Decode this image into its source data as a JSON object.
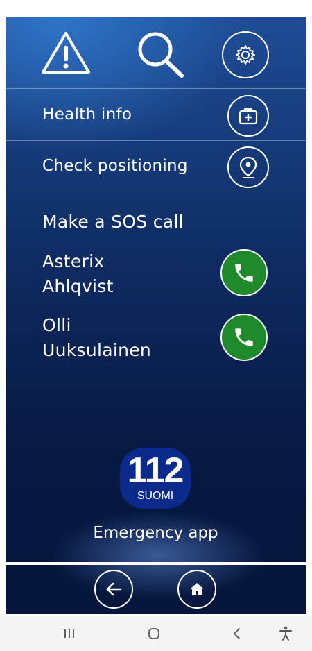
{
  "menu": {
    "health_info": "Health info",
    "check_positioning": "Check positioning"
  },
  "sos": {
    "heading": "Make a SOS call",
    "contacts": [
      {
        "first_name": "Asterix",
        "last_name": "Ahlqvist"
      },
      {
        "first_name": "Olli",
        "last_name": "Uuksulainen"
      }
    ]
  },
  "logo": {
    "number": "112",
    "country": "SUOMI"
  },
  "app_name": "Emergency app",
  "icons": {
    "warning": "warning-icon",
    "search": "search-icon",
    "settings": "gear-icon",
    "health": "medical-kit-icon",
    "location": "location-pin-icon",
    "call": "phone-icon",
    "back": "back-arrow-icon",
    "home": "home-icon"
  },
  "colors": {
    "call_button": "#1f8a2c",
    "logo_background": "#0a2a8c",
    "background_dark": "#06163c",
    "background_light": "#2f74c7"
  }
}
